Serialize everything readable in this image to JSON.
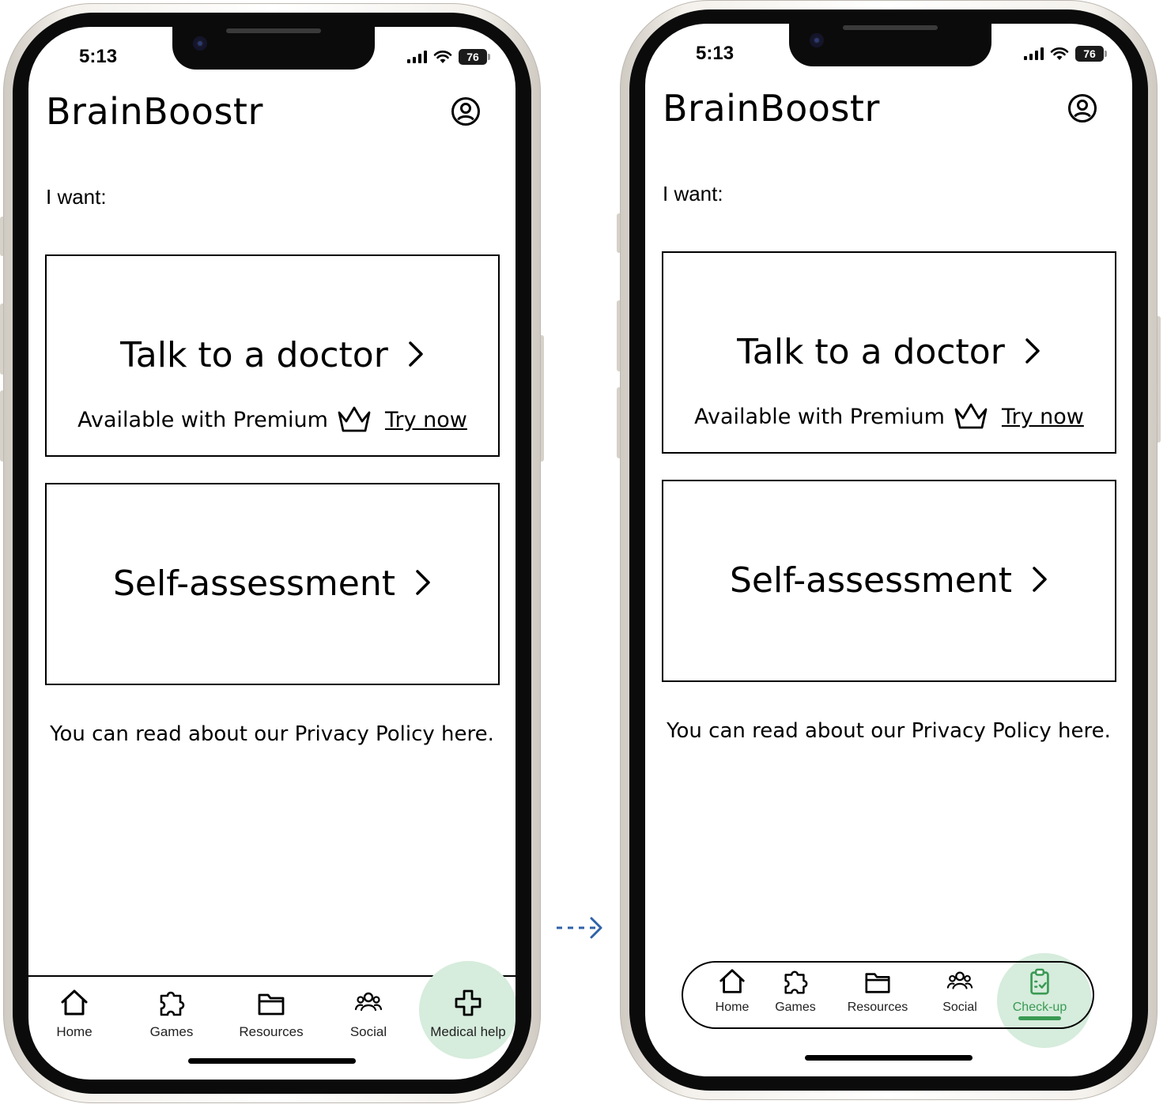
{
  "status": {
    "time": "5:13",
    "battery": "76"
  },
  "app": {
    "title": "BrainBoostr"
  },
  "content": {
    "intro": "I want:",
    "talk_card": {
      "title": "Talk to a doctor",
      "premium_text": "Available with Premium",
      "try_label": "Try now"
    },
    "self_card": {
      "title": "Self-assessment"
    },
    "privacy_text": "You can read about our Privacy Policy here."
  },
  "nav_before": {
    "items": [
      {
        "label": "Home",
        "icon": "home-icon"
      },
      {
        "label": "Games",
        "icon": "puzzle-icon"
      },
      {
        "label": "Resources",
        "icon": "folder-icon"
      },
      {
        "label": "Social",
        "icon": "people-icon"
      },
      {
        "label": "Medical help",
        "icon": "medical-cross-icon"
      }
    ],
    "active": "Medical help"
  },
  "nav_after": {
    "items": [
      {
        "label": "Home",
        "icon": "home-icon"
      },
      {
        "label": "Games",
        "icon": "puzzle-icon"
      },
      {
        "label": "Resources",
        "icon": "folder-icon"
      },
      {
        "label": "Social",
        "icon": "people-icon"
      },
      {
        "label": "Check-up",
        "icon": "clipboard-check-icon"
      }
    ],
    "active": "Check-up"
  },
  "colors": {
    "highlight": "#d6ecdc",
    "active_green": "#3a9a54",
    "flow_arrow": "#2f62a8"
  }
}
